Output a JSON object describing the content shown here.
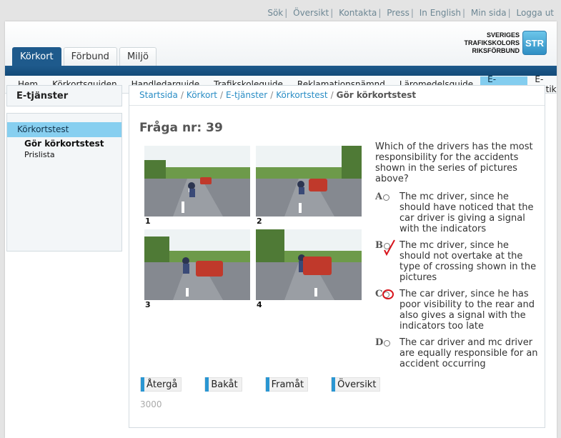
{
  "top_links": [
    "Sök",
    "Översikt",
    "Kontakta",
    "Press",
    "In English",
    "Min sida",
    "Logga ut"
  ],
  "logo": {
    "line1": "SVERIGES",
    "line2": "TRAFIKSKOLORS",
    "line3": "RIKSFÖRBUND",
    "box": "STR"
  },
  "tabs": [
    "Körkort",
    "Förbund",
    "Miljö"
  ],
  "active_tab": "Körkort",
  "nav": [
    "Hem",
    "Körkortsguiden",
    "Handledarguide",
    "Trafikskoleguide",
    "Reklamationsnämnd",
    "Läromedelsguide",
    "E-tjänster",
    "E-butik"
  ],
  "active_nav": "E-tjänster",
  "sidebar": {
    "title": "E-tjänster",
    "active_item": "Körkortstest",
    "sub_item_1": "Gör körkortstest",
    "sub_item_2": "Prislista"
  },
  "breadcrumb": {
    "items": [
      "Startsida",
      "Körkort",
      "E-tjänster",
      "Körkortstest"
    ],
    "current": "Gör körkortstest"
  },
  "question": {
    "title": "Fråga nr: 39",
    "text": "Which of the drivers has the most responsibility for the accidents shown in the series of pictures above?",
    "picture_numbers": [
      "1",
      "2",
      "3",
      "4"
    ],
    "answers": [
      {
        "letter": "A",
        "text": "The mc driver, since he should have noticed that the car driver is giving a signal with the indicators"
      },
      {
        "letter": "B",
        "text": "The mc driver, since he should not overtake at the type of crossing shown in the pictures"
      },
      {
        "letter": "C",
        "text": "The car driver, since he has poor visibility to the rear and also gives a signal with the indicators too late"
      },
      {
        "letter": "D",
        "text": "The car driver and mc driver are equally responsible for an accident occurring"
      }
    ]
  },
  "buttons": {
    "back_to": "Återgå",
    "previous": "Bakåt",
    "next": "Framåt",
    "overview": "Översikt"
  },
  "timer": "3000",
  "colors": {
    "brand_blue": "#1e5a8c",
    "active_light_blue": "#87cff0",
    "link_blue": "#2a8dc5",
    "mark_red": "#d8131b"
  }
}
